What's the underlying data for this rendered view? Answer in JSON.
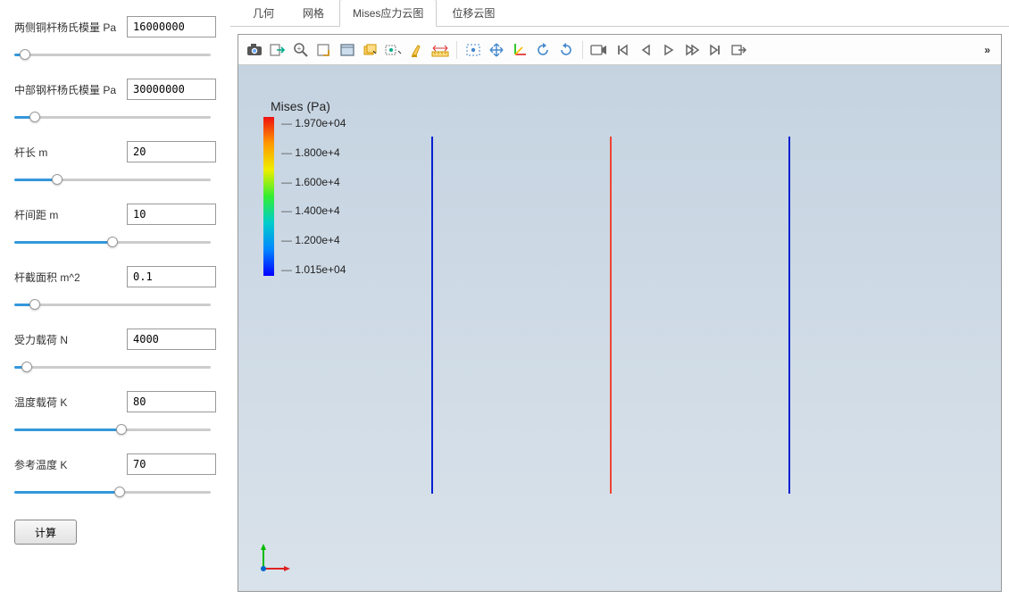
{
  "params": [
    {
      "label": "两侧铜杆杨氏模量 Pa",
      "value": "16000000",
      "slider_pct": 3
    },
    {
      "label": "中部钢杆杨氏模量 Pa",
      "value": "30000000",
      "slider_pct": 8
    },
    {
      "label": "杆长 m",
      "value": "20",
      "slider_pct": 20
    },
    {
      "label": "杆间距 m",
      "value": "10",
      "slider_pct": 50
    },
    {
      "label": "杆截面积 m^2",
      "value": "0.1",
      "slider_pct": 8
    },
    {
      "label": "受力载荷 N",
      "value": "4000",
      "slider_pct": 4
    },
    {
      "label": "温度载荷 K",
      "value": "80",
      "slider_pct": 55
    },
    {
      "label": "参考温度 K",
      "value": "70",
      "slider_pct": 54
    }
  ],
  "compute_label": "计算",
  "tabs": [
    "几何",
    "网格",
    "Mises应力云图",
    "位移云图"
  ],
  "active_tab": 2,
  "toolbar_icons": [
    "camera-icon",
    "export-icon",
    "zoom-icon",
    "select-box-icon",
    "window-icon",
    "layers-icon",
    "view-options-icon",
    "clean-icon",
    "measure-icon",
    "sep",
    "region-select-icon",
    "pan-icon",
    "axes-icon",
    "rotate-left-icon",
    "rotate-right-icon",
    "sep",
    "record-icon",
    "first-frame-icon",
    "prev-frame-icon",
    "play-icon",
    "next-frame-icon",
    "last-frame-icon",
    "export-anim-icon"
  ],
  "toolbar_more": "»",
  "legend": {
    "title": "Mises (Pa)",
    "ticks": [
      "1.970e+04",
      "1.800e+4",
      "1.600e+4",
      "1.400e+4",
      "1.200e+4",
      "1.015e+04"
    ]
  },
  "bars": [
    {
      "x": 486,
      "color": "blue"
    },
    {
      "x": 686,
      "color": "red"
    },
    {
      "x": 886,
      "color": "blue"
    }
  ],
  "chart_data": {
    "type": "contour-bars",
    "title": "Mises (Pa)",
    "colorbar_range": [
      10150.0,
      19700.0
    ],
    "colorbar_ticks": [
      19700.0,
      18000.0,
      16000.0,
      14000.0,
      12000.0,
      10150.0
    ],
    "series": [
      {
        "name": "left-copper-rod",
        "value": 10150.0
      },
      {
        "name": "center-steel-rod",
        "value": 19700.0
      },
      {
        "name": "right-copper-rod",
        "value": 10150.0
      }
    ]
  }
}
